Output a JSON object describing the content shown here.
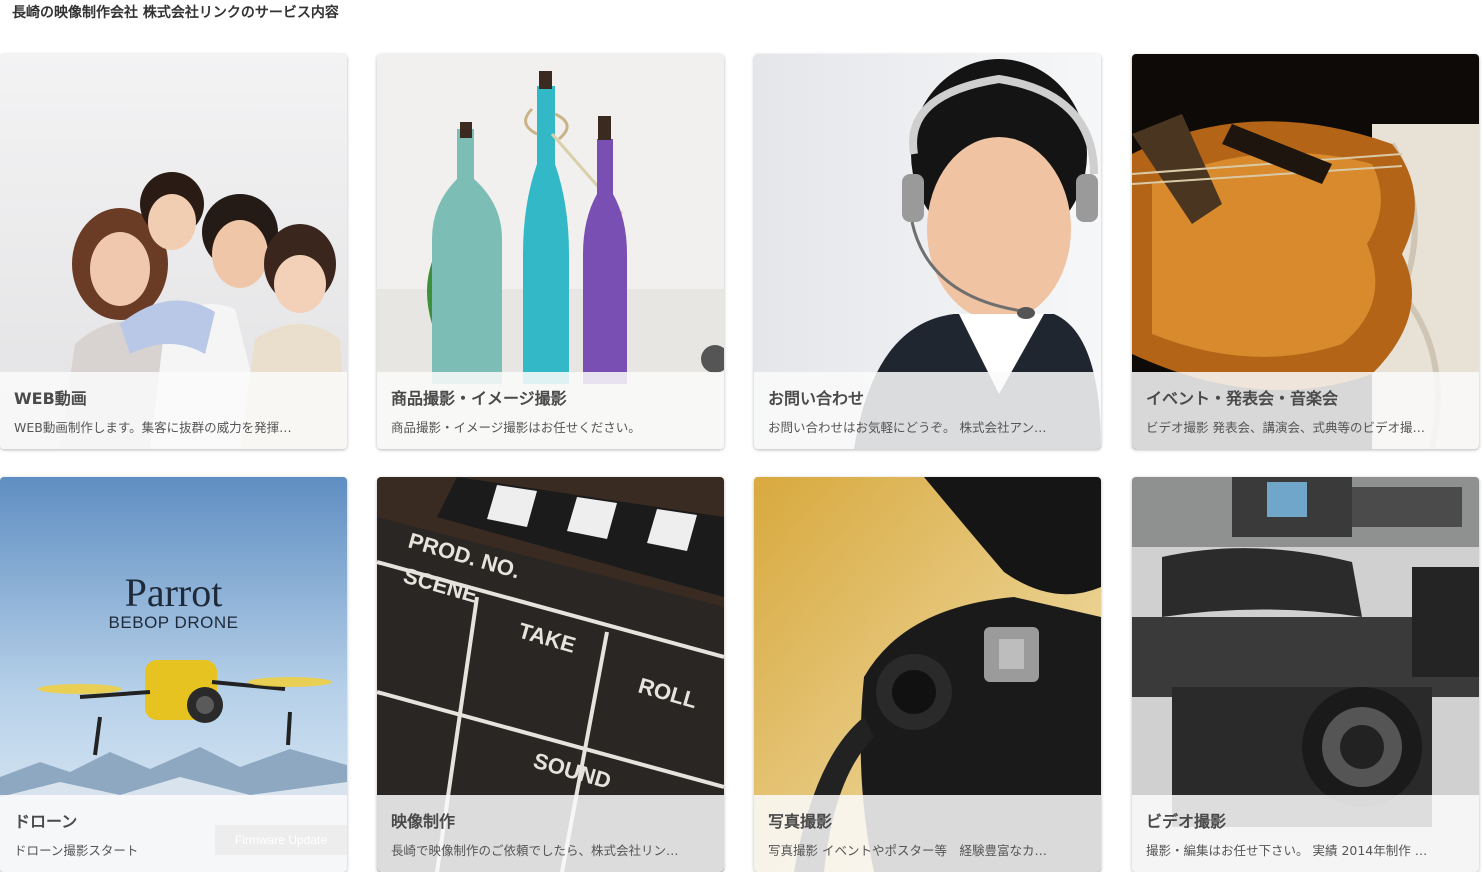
{
  "header": {
    "title": "長崎の映像制作会社 株式会社リンクのサービス内容"
  },
  "cards": [
    {
      "title": "WEB動画",
      "desc": "WEB動画制作します。集客に抜群の威力を発揮…",
      "image": "family-photo"
    },
    {
      "title": "商品撮影・イメージ撮影",
      "desc": "商品撮影・イメージ撮影はお任せください。",
      "image": "bottles-photo"
    },
    {
      "title": "お問い合わせ",
      "desc": "お問い合わせはお気軽にどうぞ。 株式会社アン…",
      "image": "operator-photo"
    },
    {
      "title": "イベント・発表会・音楽会",
      "desc": "ビデオ撮影 発表会、講演会、式典等のビデオ撮…",
      "image": "violin-photo"
    },
    {
      "title": "ドローン",
      "desc": "ドローン撮影スタート",
      "image": "drone-photo"
    },
    {
      "title": "映像制作",
      "desc": "長崎で映像制作のご依頼でしたら、株式会社リン…",
      "image": "clapperboard-photo"
    },
    {
      "title": "写真撮影",
      "desc": "写真撮影 イベントやポスター等　経験豊富なカ…",
      "image": "camera-photo"
    },
    {
      "title": "ビデオ撮影",
      "desc": "撮影・編集はお任せ下さい。 実績 2014年制作 …",
      "image": "video-camera-photo"
    }
  ],
  "drone_image": {
    "brand": "Parrot",
    "product": "BEBOP DRONE",
    "overlay_label": "Firmware Update"
  },
  "clapperboard_image": {
    "words": [
      "PROD. NO.",
      "SCENE",
      "TAKE",
      "ROLL",
      "SOUND"
    ]
  }
}
